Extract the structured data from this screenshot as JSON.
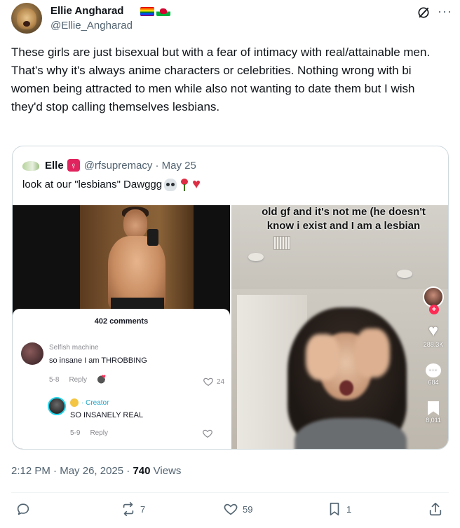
{
  "tweet": {
    "author_name": "Ellie Angharad",
    "author_handle": "@Ellie_Angharad",
    "flags": [
      "rainbow-flag",
      "wales-flag"
    ],
    "text": "These girls are just bisexual but with a fear of intimacy with real/attainable men. That's why it's always anime characters or celebrities. Nothing wrong with bi women being attracted to men while also not wanting to date them but I wish they'd stop calling themselves lesbians.",
    "time": "2:12 PM",
    "date": "May 26, 2025",
    "separator": "·",
    "views_count": "740",
    "views_label": "Views"
  },
  "quote": {
    "author_name": "Elle",
    "badge": "♀",
    "author_handle": "@rfsupremacy",
    "date": "· May 25",
    "text": "look at our \"lesbians\" Dawggg",
    "text_emojis": [
      "skull-emoji",
      "rose-emoji",
      "broken-heart-emoji"
    ]
  },
  "media_left": {
    "comments_title": "402 comments",
    "comment1": {
      "user": "Selfish machine",
      "text": "so insane I am THROBBING",
      "date": "5-8",
      "reply": "Reply",
      "likes": "24"
    },
    "comment2": {
      "creator_label": "· Creator",
      "text": "SO INSANELY REAL",
      "date": "5-9",
      "reply": "Reply"
    }
  },
  "media_right": {
    "overlay_text": "old gf and it's not me (he doesn't know i exist and I am a lesbian",
    "likes": "288.3K",
    "comments": "684",
    "saves": "8,011",
    "follow_plus": "+"
  },
  "actions": {
    "replies": "",
    "reposts": "7",
    "likes": "59",
    "bookmarks": "1"
  },
  "colors": {
    "text_primary": "#0f1419",
    "text_secondary": "#536471",
    "border": "#cfd9de",
    "tiktok_red": "#fe2c55"
  }
}
